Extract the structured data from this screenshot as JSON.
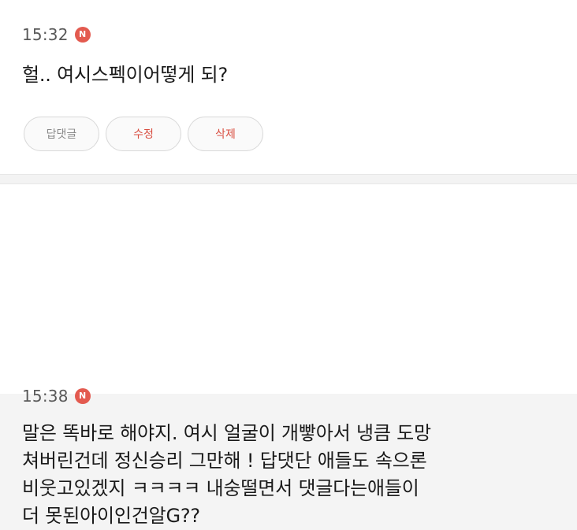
{
  "comments": [
    {
      "time": "15:32",
      "badge": "N",
      "text": "헐.. 여시스펙이어떻게 되?",
      "actions": [
        {
          "label": "답댓글",
          "tone": "neutral"
        },
        {
          "label": "수정",
          "tone": "accent"
        },
        {
          "label": "삭제",
          "tone": "accent"
        }
      ]
    },
    {
      "time": "15:38",
      "badge": "N",
      "text": "말은 똑바로 해야지. 여시 얼굴이 개빻아서 냉큼 도망\n쳐버린건데 정신승리 그만해 ! 답댓단 애들도 속으론\n비웃고있겠지 ㅋㅋㅋㅋ 내숭떨면서 댓글다는애들이\n더 못된아이인건알G??"
    }
  ],
  "colors": {
    "accent": "#d94f42",
    "badge": "#e35a4f",
    "muted": "#8a8a8a",
    "divider": "#e7e7e7"
  }
}
